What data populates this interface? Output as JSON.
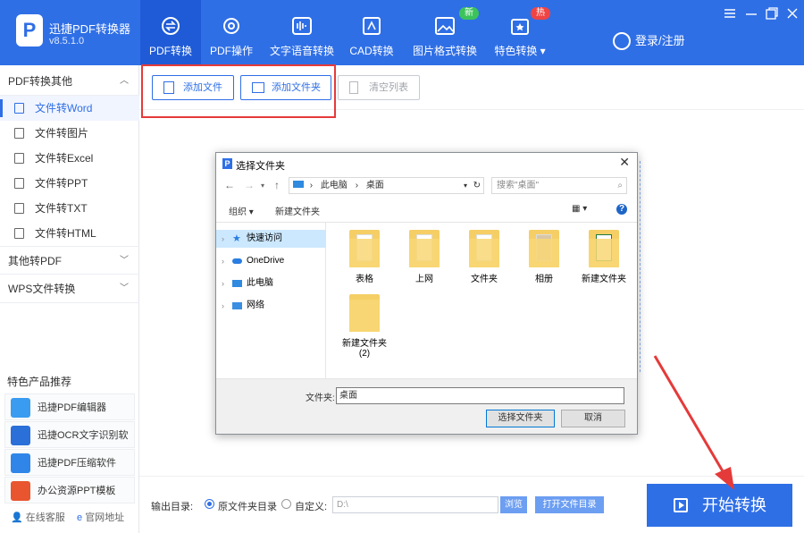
{
  "app": {
    "name": "迅捷PDF转换器",
    "version": "v8.5.1.0"
  },
  "nav": [
    {
      "label": "PDF转换",
      "icon": "convert-icon"
    },
    {
      "label": "PDF操作",
      "icon": "gear-icon"
    },
    {
      "label": "文字语音转换",
      "icon": "audio-wave-icon"
    },
    {
      "label": "CAD转换",
      "icon": "cad-icon"
    },
    {
      "label": "图片格式转换",
      "icon": "image-icon",
      "badge": "新"
    },
    {
      "label": "特色转换",
      "icon": "star-box-icon",
      "badge": "热"
    }
  ],
  "login": "登录/注册",
  "sidebar": {
    "group1": "PDF转换其他",
    "items": [
      "文件转Word",
      "文件转图片",
      "文件转Excel",
      "文件转PPT",
      "文件转TXT",
      "文件转HTML"
    ],
    "group2": "其他转PDF",
    "group3": "WPS文件转换",
    "rec_title": "特色产品推荐",
    "recs": [
      "迅捷PDF编辑器",
      "迅捷OCR文字识别软件",
      "迅捷PDF压缩软件",
      "办公资源PPT模板"
    ],
    "footer": [
      "在线客服",
      "官网地址"
    ]
  },
  "toolbar": {
    "add_file": "添加文件",
    "add_folder": "添加文件夹",
    "clear": "清空列表"
  },
  "bottom": {
    "out_label": "输出目录:",
    "opt_orig": "原文件夹目录",
    "opt_custom": "自定义:",
    "path": "D:\\",
    "browse": "浏览",
    "open_folder": "打开文件目录",
    "start": "开始转换"
  },
  "dialog": {
    "title": "选择文件夹",
    "address": [
      "此电脑",
      "桌面"
    ],
    "search_placeholder": "搜索\"桌面\"",
    "organize": "组织 ▾",
    "new_folder": "新建文件夹",
    "tree": [
      "快速访问",
      "OneDrive",
      "此电脑",
      "网络"
    ],
    "files": [
      "表格",
      "上网",
      "文件夹",
      "相册",
      "新建文件夹",
      "新建文件夹\n(2)"
    ],
    "folder_label": "文件夹:",
    "folder_value": "桌面",
    "select": "选择文件夹",
    "cancel": "取消"
  },
  "colors": {
    "accent": "#2f6fe6",
    "highlight": "#e53a3a",
    "new_badge": "#3cc35c",
    "hot_badge": "#f04444"
  }
}
